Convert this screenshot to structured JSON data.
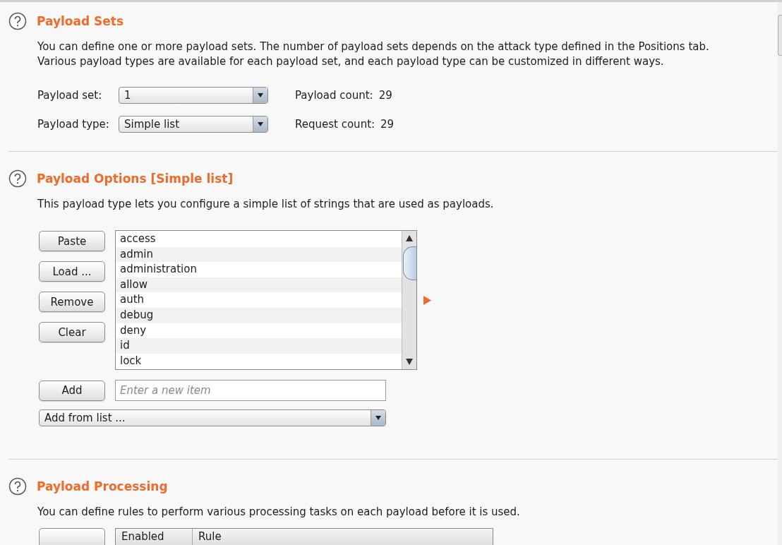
{
  "payload_sets": {
    "title": "Payload Sets",
    "description": "You can define one or more payload sets. The number of payload sets depends on the attack type defined in the Positions tab. Various payload types are available for each payload set, and each payload type can be customized in different ways.",
    "rows": [
      {
        "label": "Payload set:",
        "value": "1",
        "count_label": "Payload count:",
        "count": "29"
      },
      {
        "label": "Payload type:",
        "value": "Simple list",
        "count_label": "Request count:",
        "count": "29"
      }
    ]
  },
  "payload_options": {
    "title": "Payload Options [Simple list]",
    "description": "This payload type lets you configure a simple list of strings that are used as payloads.",
    "buttons": [
      "Paste",
      "Load ...",
      "Remove",
      "Clear"
    ],
    "items": [
      "access",
      "admin",
      "administration",
      "allow",
      "auth",
      "debug",
      "deny",
      "id",
      "lock"
    ],
    "add_button": "Add",
    "new_item_placeholder": "Enter a new item",
    "add_from_list": "Add from list ..."
  },
  "payload_processing": {
    "title": "Payload Processing",
    "description": "You can define rules to perform various processing tasks on each payload before it is used.",
    "table": {
      "columns": [
        "Enabled",
        "Rule"
      ]
    }
  }
}
